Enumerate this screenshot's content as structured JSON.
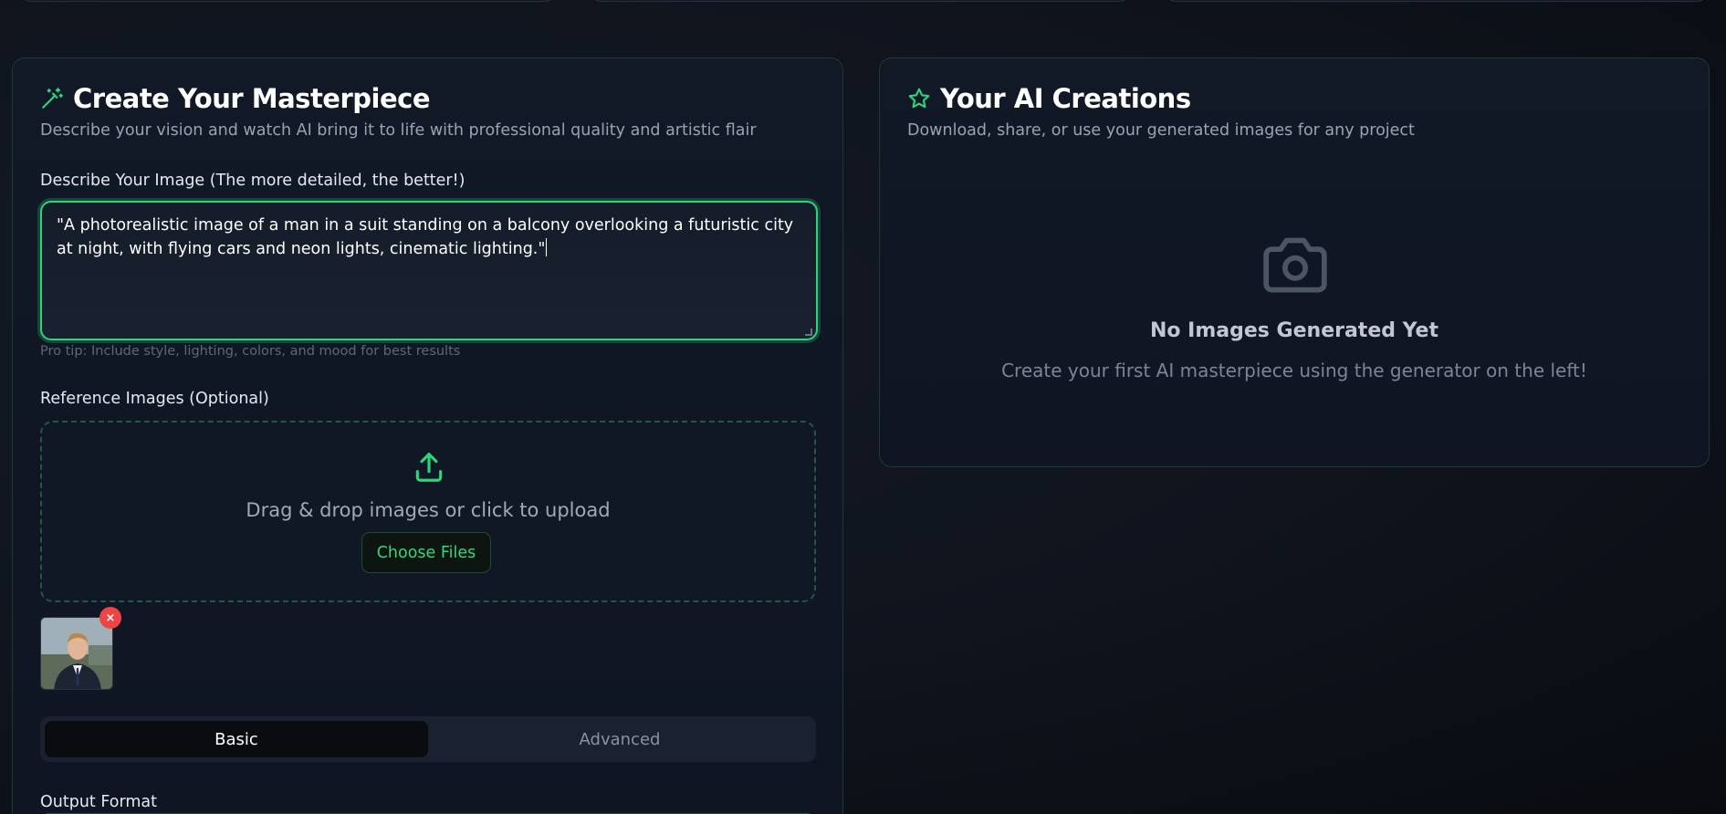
{
  "colors": {
    "accent": "#2ed47a",
    "remove": "#ef4444",
    "panel_border": "#1e3a35"
  },
  "generator": {
    "title": "Create Your Masterpiece",
    "title_icon": "magic-wand-icon",
    "subtitle": "Describe your vision and watch AI bring it to life with professional quality and artistic flair",
    "prompt_label": "Describe Your Image (The more detailed, the better!)",
    "prompt_value": " \"A photorealistic image of a man in a suit standing on a balcony overlooking a futuristic city at night, with flying cars and neon lights, cinematic lighting.\"",
    "pro_tip": "Pro tip: Include style, lighting, colors, and mood for best results",
    "reference_label": "Reference Images (Optional)",
    "upload_icon": "upload-icon",
    "dropzone_text": "Drag & drop images or click to upload",
    "choose_files": "Choose Files",
    "remove_label": "×",
    "tabs": [
      {
        "label": "Basic",
        "active": true
      },
      {
        "label": "Advanced",
        "active": false
      }
    ],
    "output_format_label": "Output Format"
  },
  "creations": {
    "title": "Your AI Creations",
    "title_icon": "star-icon",
    "subtitle": "Download, share, or use your generated images for any project",
    "empty_icon": "camera-icon",
    "empty_title": "No Images Generated Yet",
    "empty_subtitle": "Create your first AI masterpiece using the generator on the left!"
  }
}
